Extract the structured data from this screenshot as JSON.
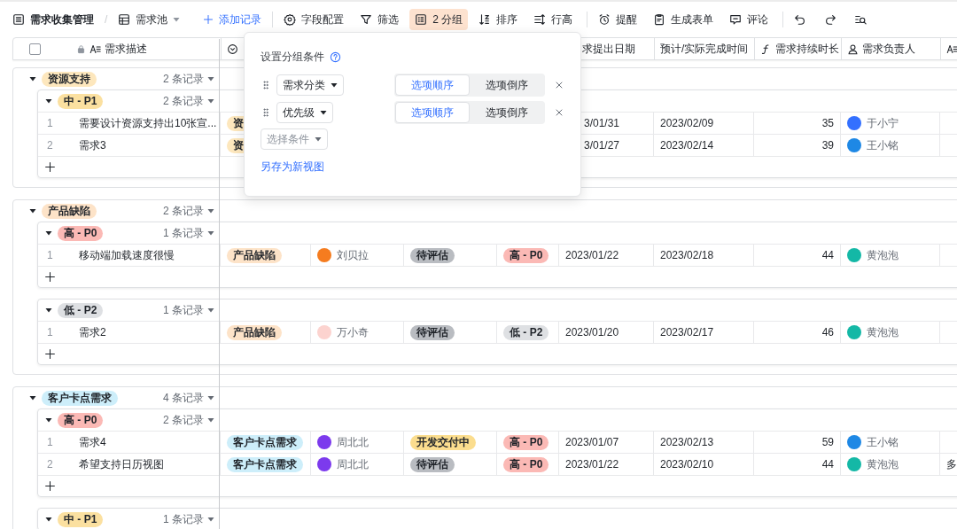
{
  "toolbar": {
    "breadcrumb": {
      "kind": "table",
      "label": "需求收集管理"
    },
    "separator": "/",
    "view": {
      "kind": "grid",
      "label": "需求池"
    },
    "add": {
      "label": "添加记录"
    },
    "tool_groups": [
      [
        {
          "kind": "settings",
          "label": "字段配置",
          "selected": false
        },
        {
          "kind": "filter",
          "label": "筛选",
          "selected": false
        },
        {
          "kind": "group",
          "label": "2 分组",
          "selected": true
        },
        {
          "kind": "sort",
          "label": "排序",
          "selected": false
        },
        {
          "kind": "height",
          "label": "行高",
          "selected": false
        }
      ],
      [
        {
          "kind": "alarm",
          "label": "提醒",
          "selected": false
        },
        {
          "kind": "form",
          "label": "生成表单",
          "selected": false
        },
        {
          "kind": "comment",
          "label": "评论",
          "selected": false
        }
      ],
      [
        {
          "kind": "undo",
          "selected": false
        },
        {
          "kind": "redo",
          "selected": false
        },
        {
          "kind": "find",
          "selected": false
        }
      ]
    ]
  },
  "select_all": {
    "checked": false
  },
  "columns": [
    {
      "kind": "text",
      "label": "需求描述",
      "locked": true
    },
    {
      "kind": "select"
    },
    {
      "kind": "date",
      "label": "求提出日期"
    },
    {
      "kind": "plain",
      "label": "预计/实际完成时间"
    },
    {
      "kind": "formula",
      "label": "需求持续时长"
    },
    {
      "kind": "person",
      "label": "需求负责人"
    },
    {
      "kind": "text"
    }
  ],
  "groups": [
    {
      "label": "资源支持",
      "color": "#fde7bd",
      "count": "2 条记录",
      "expanded": true,
      "subgroups": [
        {
          "label": "中 - P1",
          "color": "#fbe0a0",
          "count": "2 条记录",
          "expanded": true,
          "rows": [
            {
              "no": "1",
              "title": "需要设计资源支持出10张宣...",
              "category": {
                "label": "资",
                "color": "#fde7bd"
              },
              "start": "3/01/31",
              "end": "2023/02/09",
              "days": "35",
              "assignee": {
                "name": "于小宁",
                "color": "#3370ff"
              }
            },
            {
              "no": "2",
              "title": "需求3",
              "category": {
                "label": "资",
                "color": "#fde7bd"
              },
              "start": "3/01/27",
              "end": "2023/02/14",
              "days": "39",
              "assignee": {
                "name": "王小铭",
                "color": "#1e88e5"
              }
            }
          ]
        }
      ]
    },
    {
      "label": "产品缺陷",
      "color": "#fde3c8",
      "count": "2 条记录",
      "expanded": true,
      "subgroups": [
        {
          "label": "高 - P0",
          "color": "#fbb9b5",
          "count": "1 条记录",
          "expanded": true,
          "rows": [
            {
              "no": "1",
              "title": "移动端加载速度很慢",
              "category": {
                "label": "产品缺陷",
                "color": "#fde3c8"
              },
              "owner": {
                "name": "刘贝拉",
                "color": "#f57c1f"
              },
              "status": {
                "label": "待评估",
                "color": "#b9bcc1"
              },
              "priority": {
                "label": "高 - P0",
                "color": "#fbb9b5"
              },
              "start": "2023/01/22",
              "end": "2023/02/18",
              "days": "44",
              "assignee": {
                "name": "黄泡泡",
                "color": "#14b8a6"
              }
            }
          ]
        },
        {
          "label": "低 - P2",
          "color": "#dee0e3",
          "count": "1 条记录",
          "expanded": true,
          "rows": [
            {
              "no": "1",
              "title": "需求2",
              "category": {
                "label": "产品缺陷",
                "color": "#fde3c8"
              },
              "owner": {
                "name": "万小奇",
                "color": "#fcd3cf"
              },
              "status": {
                "label": "待评估",
                "color": "#b9bcc1"
              },
              "priority": {
                "label": "低 - P2",
                "color": "#dee0e3"
              },
              "start": "2023/01/20",
              "end": "2023/02/17",
              "days": "46",
              "assignee": {
                "name": "黄泡泡",
                "color": "#14b8a6"
              }
            }
          ]
        }
      ]
    },
    {
      "label": "客户卡点需求",
      "color": "#cdeefa",
      "count": "4 条记录",
      "expanded": true,
      "subgroups": [
        {
          "label": "高 - P0",
          "color": "#fbb9b5",
          "count": "2 条记录",
          "expanded": true,
          "rows": [
            {
              "no": "1",
              "title": "需求4",
              "category": {
                "label": "客户卡点需求",
                "color": "#cdeefa"
              },
              "owner": {
                "name": "周北北",
                "color": "#7c3aed"
              },
              "status": {
                "label": "开发交付中",
                "color": "#fbdd8e"
              },
              "priority": {
                "label": "高 - P0",
                "color": "#fbb9b5"
              },
              "start": "2023/01/07",
              "end": "2023/02/13",
              "days": "59",
              "assignee": {
                "name": "王小铭",
                "color": "#1e88e5"
              }
            },
            {
              "no": "2",
              "title": "希望支持日历视图",
              "category": {
                "label": "客户卡点需求",
                "color": "#cdeefa"
              },
              "owner": {
                "name": "周北北",
                "color": "#7c3aed"
              },
              "status": {
                "label": "待评估",
                "color": "#b9bcc1"
              },
              "priority": {
                "label": "高 - P0",
                "color": "#fbb9b5"
              },
              "start": "2023/01/22",
              "end": "2023/02/10",
              "days": "44",
              "assignee": {
                "name": "黄泡泡",
                "color": "#14b8a6"
              },
              "extra": "多"
            }
          ]
        },
        {
          "label": "中 - P1",
          "color": "#fbe0a0",
          "count": "1 条记录",
          "expanded": true
        }
      ]
    }
  ],
  "popup": {
    "title": "设置分组条件",
    "conditions": [
      {
        "field": "需求分类",
        "options": [
          {
            "label": "选项顺序",
            "selected": true
          },
          {
            "label": "选项倒序",
            "selected": false
          }
        ]
      },
      {
        "field": "优先级",
        "options": [
          {
            "label": "选项顺序",
            "selected": true
          },
          {
            "label": "选项倒序",
            "selected": false
          }
        ]
      }
    ],
    "placeholder": "选择条件",
    "link": "另存为新视图"
  }
}
